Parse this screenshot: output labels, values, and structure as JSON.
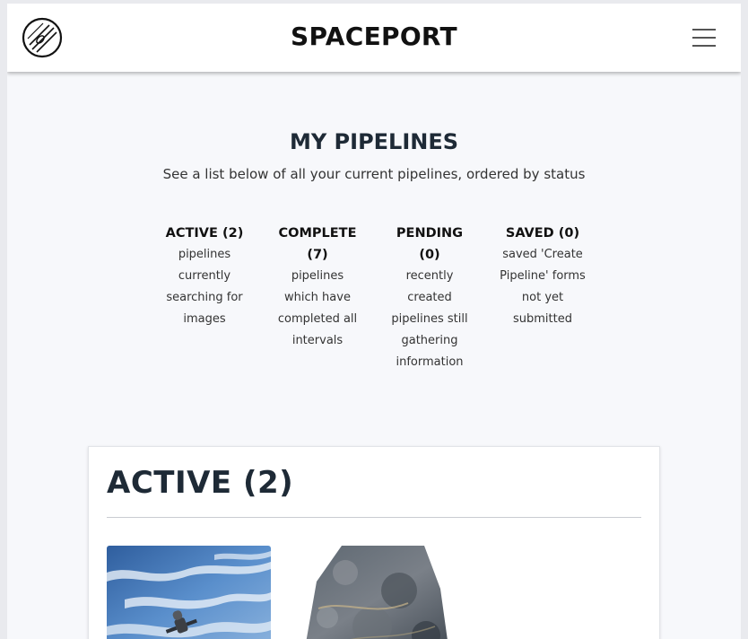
{
  "header": {
    "brand": "SPACEPORT",
    "logo_icon": "planet-logo-icon",
    "menu_icon": "hamburger-menu-icon"
  },
  "intro": {
    "title": "MY PIPELINES",
    "subtitle": "See a list below of all your current pipelines, ordered by status"
  },
  "statuses": [
    {
      "label": "ACTIVE (2)",
      "description": "pipelines currently searching for images"
    },
    {
      "label": "COMPLETE (7)",
      "description": "pipelines which have completed all intervals"
    },
    {
      "label": "PENDING (0)",
      "description": "recently created pipelines still gathering information"
    },
    {
      "label": "SAVED (0)",
      "description": "saved 'Create Pipeline' forms not yet submitted"
    }
  ],
  "active_section": {
    "title": "ACTIVE (2)",
    "thumbnails": [
      {
        "icon": "satellite-sky-image"
      },
      {
        "icon": "satellite-terrain-image"
      }
    ]
  },
  "colors": {
    "page_background": "#f7f8fb",
    "header_background": "#ffffff",
    "heading_text": "#1e2a36",
    "sky_blue": "#4a78b8"
  }
}
